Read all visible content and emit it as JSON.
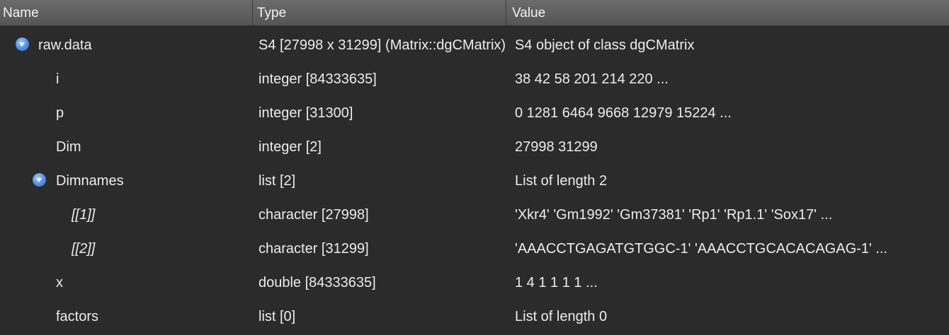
{
  "header": {
    "name": "Name",
    "type": "Type",
    "value": "Value"
  },
  "rows": [
    {
      "name": "raw.data",
      "type": "S4 [27998 x 31299] (Matrix::dgCMatrix)",
      "value": "S4 object of class dgCMatrix",
      "expand": "expanded-toggle-icon"
    },
    {
      "name": "i",
      "type": "integer [84333635]",
      "value": "38 42 58 201 214 220 ..."
    },
    {
      "name": "p",
      "type": "integer [31300]",
      "value": "0 1281 6464 9668 12979 15224 ..."
    },
    {
      "name": "Dim",
      "type": "integer [2]",
      "value": "27998 31299"
    },
    {
      "name": "Dimnames",
      "type": "list [2]",
      "value": "List of length 2",
      "expand": "expanded-toggle-icon"
    },
    {
      "name": "[[1]]",
      "type": "character [27998]",
      "value": "'Xkr4' 'Gm1992' 'Gm37381' 'Rp1' 'Rp1.1' 'Sox17' ..."
    },
    {
      "name": "[[2]]",
      "type": "character [31299]",
      "value": "'AAACCTGAGATGTGGC-1' 'AAACCTGCACACAGAG-1' ..."
    },
    {
      "name": "x",
      "type": "double [84333635]",
      "value": "1 4 1 1 1 1 ..."
    },
    {
      "name": "factors",
      "type": "list [0]",
      "value": "List of length 0"
    }
  ]
}
